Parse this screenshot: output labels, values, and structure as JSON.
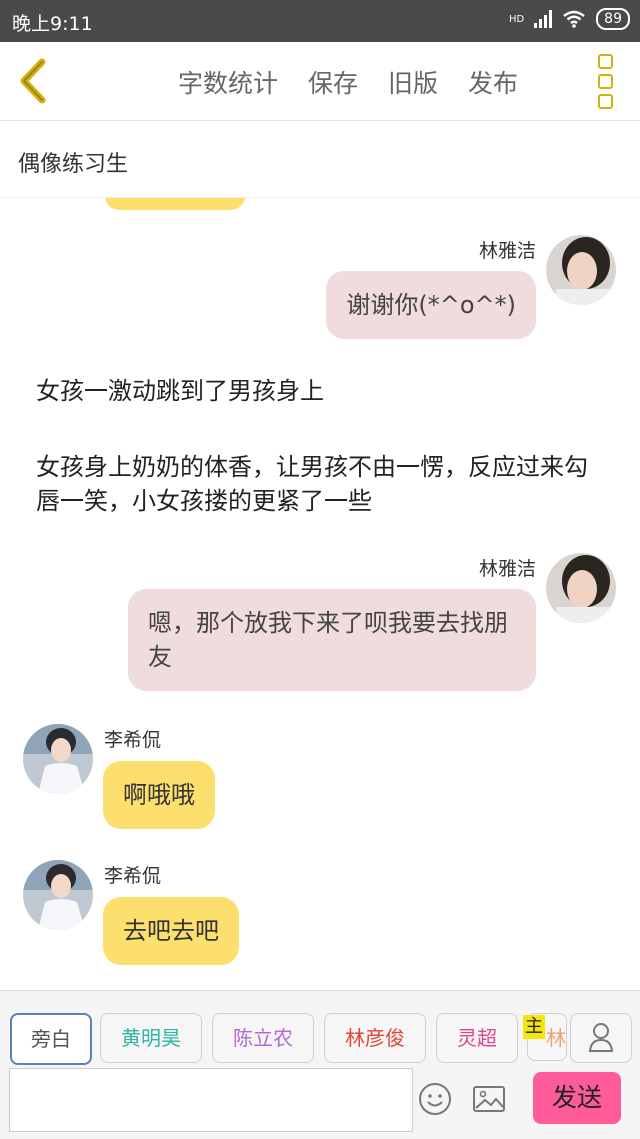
{
  "status": {
    "time": "晚上9:11",
    "network": "HD",
    "battery": "89"
  },
  "toolbar": {
    "items": [
      "字数统计",
      "保存",
      "旧版",
      "发布"
    ]
  },
  "title": "偶像练习生",
  "messages": [
    {
      "speaker": "林雅洁",
      "text": "谢谢你(*^o^*)"
    },
    {
      "narration_1": "女孩一激动跳到了男孩身上"
    },
    {
      "narration_2": "女孩身上奶奶的体香，让男孩不由一愣，反应过来勾唇一笑，小女孩搂的更紧了一些"
    },
    {
      "speaker": "林雅洁",
      "text": "嗯，那个放我下来了呗我要去找朋友"
    },
    {
      "speaker": "李希侃",
      "text": "啊哦哦"
    },
    {
      "speaker": "李希侃",
      "text": "去吧去吧"
    }
  ],
  "characters": [
    {
      "label": "旁白",
      "color": "#555555"
    },
    {
      "label": "黄明昊",
      "color": "#2fb3a6"
    },
    {
      "label": "陈立农",
      "color": "#b36ad0"
    },
    {
      "label": "林彦俊",
      "color": "#e0453a"
    },
    {
      "label": "灵超",
      "color": "#e0458a"
    },
    {
      "label": "林",
      "color": "#f0a070"
    }
  ],
  "main_mark": "主",
  "input": {
    "placeholder": ""
  },
  "send_label": "发送",
  "colors": {
    "pink_bubble": "#f1dcdd",
    "yellow_bubble": "#fddf6e",
    "send": "#ff5a9a",
    "accent": "#d4b20a"
  }
}
